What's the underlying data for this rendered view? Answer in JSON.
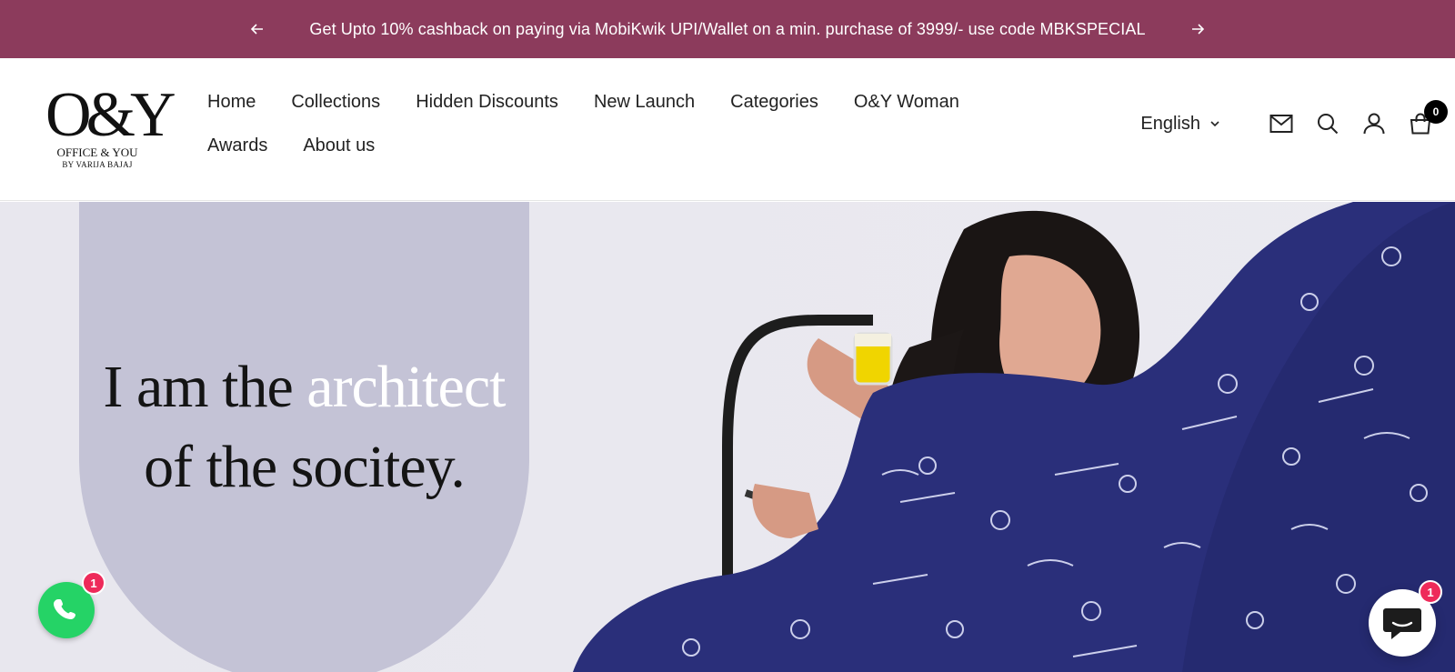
{
  "announcement": {
    "text": "Get Upto 10% cashback on paying via MobiKwik UPI/Wallet on a min. purchase of 3999/- use code MBKSPECIAL",
    "prev_icon": "arrow-left-icon",
    "next_icon": "arrow-right-icon",
    "background": "#8c3b5c"
  },
  "logo": {
    "mark": "O&Y",
    "line1": "OFFICE & YOU",
    "line2": "BY VARIJA BAJAJ"
  },
  "nav": {
    "items": [
      "Home",
      "Collections",
      "Hidden Discounts",
      "New Launch",
      "Categories",
      "O&Y Woman",
      "Awards",
      "About us"
    ]
  },
  "header_right": {
    "language": "English",
    "icons": [
      "mail-icon",
      "search-icon",
      "account-icon",
      "cart-icon"
    ],
    "cart_count": "0"
  },
  "hero": {
    "line1_dark": "I am the ",
    "line1_light": "architect",
    "line2": "of the socitey.",
    "arch_color": "#c4c3d6",
    "saree_color": "#2a2f7a"
  },
  "widgets": {
    "whatsapp_badge": "1",
    "chat_badge": "1",
    "whatsapp_color": "#25d366"
  }
}
